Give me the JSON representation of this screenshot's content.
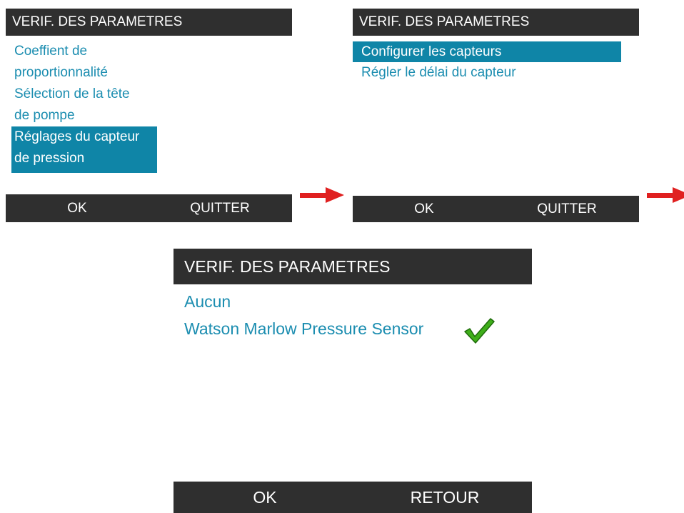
{
  "screen1": {
    "title": "VERIF. DES PARAMETRES",
    "items": [
      "Coeffient de",
      "proportionnalité",
      "Sélection de la tête",
      "de pompe",
      "Réglages du capteur",
      "de pression"
    ],
    "ok": "OK",
    "quit": "QUITTER"
  },
  "screen2": {
    "title": "VERIF. DES PARAMETRES",
    "items": [
      "Configurer les capteurs",
      "Régler le délai du capteur"
    ],
    "ok": "OK",
    "quit": "QUITTER"
  },
  "screen3": {
    "title": "VERIF. DES PARAMETRES",
    "items": [
      "Aucun",
      "Watson Marlow Pressure Sensor"
    ],
    "ok": "OK",
    "back": "RETOUR"
  },
  "colors": {
    "bar": "#2f2f2f",
    "text": "#1b8db0",
    "selection": "#0f85a7",
    "arrow": "#e02020",
    "check": "#3fae1a"
  },
  "icons": [
    "right-arrow-icon",
    "checkmark-icon"
  ]
}
